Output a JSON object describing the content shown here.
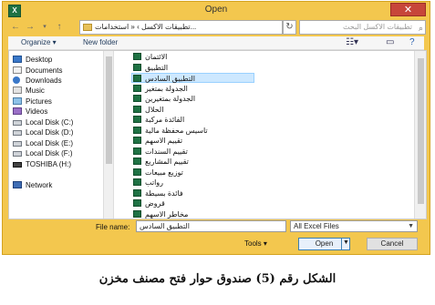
{
  "dialog": {
    "app_icon": "X",
    "title": "Open",
    "close_glyph": "✕"
  },
  "address": {
    "back_icon": "arrow-left-icon",
    "forward_icon": "arrow-right-icon",
    "up_icon": "arrow-up-icon",
    "path": "تطبيقات الاكسل  ›  « استخدامات...",
    "search_placeholder": "تطبيقات الاكسل البحث"
  },
  "toolbar": {
    "organize": "Organize ▾",
    "new_folder": "New folder"
  },
  "nav_items": [
    {
      "label": "Desktop",
      "icon": "desktop"
    },
    {
      "label": "Documents",
      "icon": "docs"
    },
    {
      "label": "Downloads",
      "icon": "down"
    },
    {
      "label": "Music",
      "icon": "music"
    },
    {
      "label": "Pictures",
      "icon": "pics"
    },
    {
      "label": "Videos",
      "icon": "video"
    },
    {
      "label": "Local Disk (C:)",
      "icon": "disk"
    },
    {
      "label": "Local Disk (D:)",
      "icon": "disk"
    },
    {
      "label": "Local Disk (E:)",
      "icon": "disk"
    },
    {
      "label": "Local Disk (F:)",
      "icon": "disk"
    },
    {
      "label": "TOSHIBA (H:)",
      "icon": "usb"
    },
    {
      "label": "Network",
      "icon": "net"
    }
  ],
  "files": [
    "الائتمان",
    "التطبيق",
    "التطبيق السادس",
    "الجدولة بمتغير",
    "الجدولة بمتغيرين",
    "الحلال",
    "الفائدة مركبة",
    "تاسيس محفظة مالية",
    "تقييم الاسهم",
    "تقييم السندات",
    "تقييم المشاريع",
    "توزيع مبيعات",
    "رواتب",
    "فائدة بسيطة",
    "قروض",
    "مخاطر الاسهم"
  ],
  "selected_file_index": 2,
  "bottom": {
    "file_name_label": "File name:",
    "file_name_value": "التطبيق السادس",
    "file_type": "All Excel Files",
    "tools": "Tools ▾",
    "open": "Open",
    "cancel": "Cancel"
  },
  "caption": "الشكل رقم (5) صندوق حوار فتح مصنف مخزن"
}
